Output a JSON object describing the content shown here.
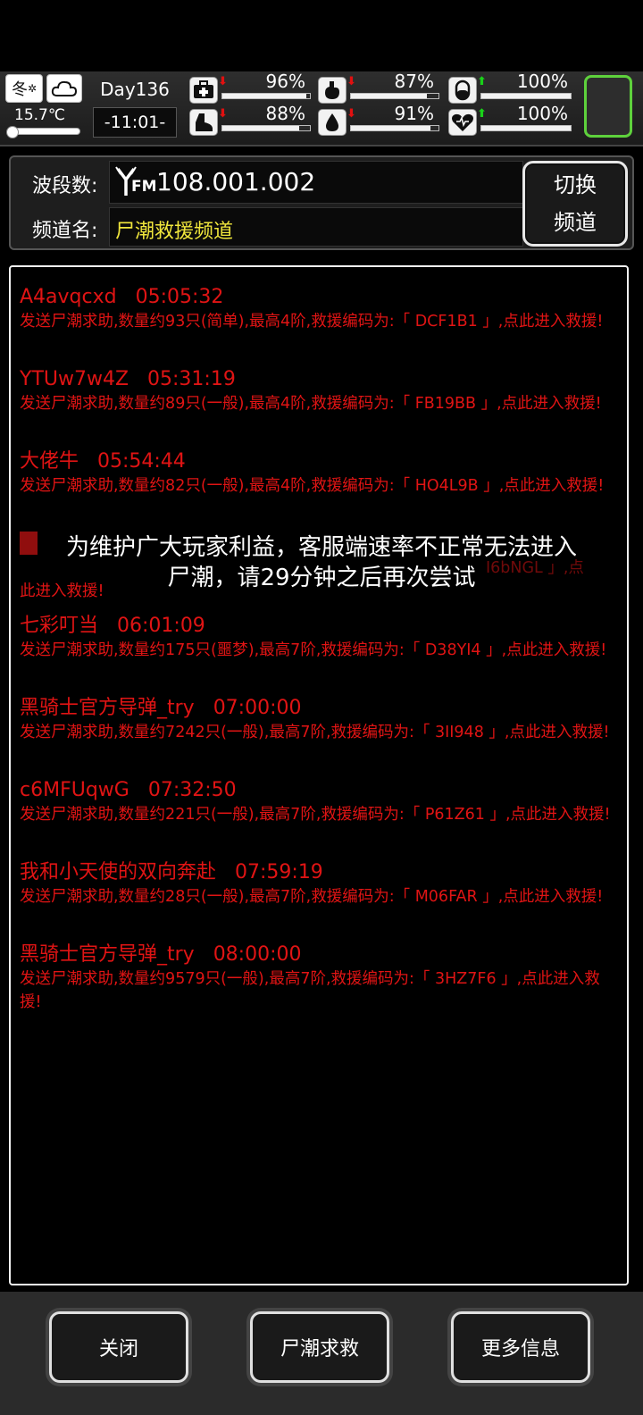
{
  "status": {
    "season": "冬",
    "temperature": "15.7℃",
    "day": "Day136",
    "time": "-11:01-",
    "stats": [
      {
        "icon": "medkit-icon",
        "value": "96%",
        "trend": "down",
        "level": 0.96
      },
      {
        "icon": "stomach-icon",
        "value": "87%",
        "trend": "down",
        "level": 0.87
      },
      {
        "icon": "pill-icon",
        "value": "100%",
        "trend": "up",
        "level": 1.0
      },
      {
        "icon": "foot-icon",
        "value": "88%",
        "trend": "down",
        "level": 0.88
      },
      {
        "icon": "water-drop-icon",
        "value": "91%",
        "trend": "down",
        "level": 0.91
      },
      {
        "icon": "heart-icon",
        "value": "100%",
        "trend": "up",
        "level": 1.0
      }
    ]
  },
  "radio": {
    "band_label": "波段数:",
    "band_value": "108.001.002",
    "fm": "FM",
    "channel_label": "频道名:",
    "channel_value": "尸潮救援频道",
    "switch_line1": "切换",
    "switch_line2": "频道"
  },
  "messages": [
    {
      "name": "A4avqcxd",
      "time": "05:05:32",
      "body": "发送尸潮求助,数量约93只(简单),最高4阶,救援编码为:「 DCF1B1 」,点此进入救援!"
    },
    {
      "name": "YTUw7w4Z",
      "time": "05:31:19",
      "body": "发送尸潮求助,数量约89只(一般),最高4阶,救援编码为:「 FB19BB 」,点此进入救援!"
    },
    {
      "name": "大佬牛",
      "time": "05:54:44",
      "body": "发送尸潮求助,数量约82只(一般),最高4阶,救援编码为:「 HO4L9B 」,点此进入救援!"
    },
    {
      "name": "",
      "time": "",
      "body": ""
    },
    {
      "name": "七彩叮当",
      "time": "06:01:09",
      "body": "发送尸潮求助,数量约175只(噩梦),最高7阶,救援编码为:「 D38YI4 」,点此进入救援!"
    },
    {
      "name": "黑骑士官方导弹_try",
      "time": "07:00:00",
      "body": "发送尸潮求助,数量约7242只(一般),最高7阶,救援编码为:「 3II948 」,点此进入救援!"
    },
    {
      "name": "c6MFUqwG",
      "time": "07:32:50",
      "body": "发送尸潮求助,数量约221只(一般),最高7阶,救援编码为:「 P61Z61 」,点此进入救援!"
    },
    {
      "name": "我和小天使的双向奔赴",
      "time": "07:59:19",
      "body": "发送尸潮求助,数量约28只(一般),最高7阶,救援编码为:「 M06FAR 」,点此进入救援!"
    },
    {
      "name": "黑骑士官方导弹_try",
      "time": "08:00:00",
      "body": "发送尸潮求助,数量约9579只(一般),最高7阶,救援编码为:「 3HZ7F6 」,点此进入救援!"
    }
  ],
  "partial_message": {
    "body_tail": "此进入救援!",
    "code_fragment": "I6bNGL 」,点"
  },
  "toast": {
    "line1": "为维护广大玩家利益，客服端速率不正常无法进入",
    "line2": "尸潮，请29分钟之后再次尝试"
  },
  "buttons": {
    "close": "关闭",
    "help": "尸潮求救",
    "more": "更多信息"
  }
}
